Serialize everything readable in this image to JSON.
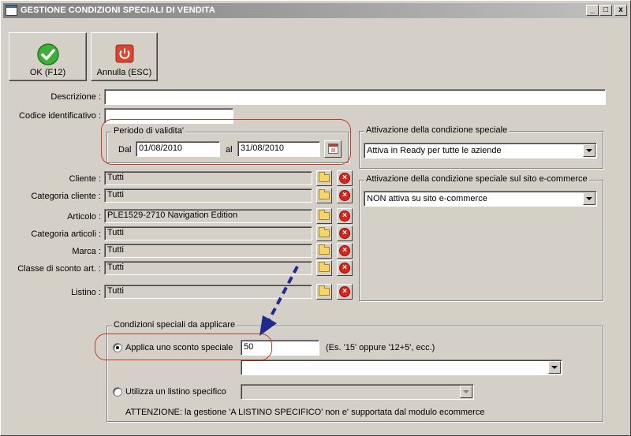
{
  "window": {
    "title": "GESTIONE CONDIZIONI SPECIALI DI VENDITA",
    "controls": {
      "minimize": "_",
      "maximize": "□",
      "close": "x"
    }
  },
  "toolbar": {
    "ok_label": "OK (F12)",
    "cancel_label": "Annulla (ESC)"
  },
  "form": {
    "descrizione_label": "Descrizione :",
    "descrizione_value": "",
    "codice_label": "Codice identificativo :",
    "codice_value": ""
  },
  "periodo": {
    "title": "Periodo di validita'",
    "dal_label": "Dal",
    "dal_value": "01/08/2010",
    "al_label": "al",
    "al_value": "31/08/2010"
  },
  "filters": [
    {
      "label": "Cliente :",
      "value": "Tutti"
    },
    {
      "label": "Categoria cliente :",
      "value": "Tutti"
    },
    {
      "label": "Articolo :",
      "value": "PLE1529-2710 Navigation Edition"
    },
    {
      "label": "Categoria articoli :",
      "value": "Tutti"
    },
    {
      "label": "Marca :",
      "value": "Tutti"
    },
    {
      "label": "Classe di sconto art. :",
      "value": "Tutti"
    },
    {
      "label": "Listino :",
      "value": "Tutti"
    }
  ],
  "attivazione": {
    "title": "Attivazione della condizione speciale",
    "selected": "Attiva in Ready per tutte le aziende"
  },
  "attivazione_sito": {
    "title": "Attivazione della condizione speciale sul sito e-commerce",
    "selected": "NON attiva su sito e-commerce"
  },
  "condizioni": {
    "title": "Condizioni speciali da applicare",
    "sconto_label": "Applica uno sconto speciale",
    "sconto_value": "50",
    "sconto_hint": "(Es. '15' oppure '12+5', ecc.)",
    "sconto_combo_value": "",
    "listino_label": "Utilizza un listino specifico",
    "listino_combo_value": "",
    "warning": "ATTENZIONE: la gestione 'A LISTINO SPECIFICO' non e' supportata dal modulo ecommerce"
  },
  "annotations": {
    "highlight_color": "#c0392b",
    "arrow_color": "#1f2a8f"
  }
}
